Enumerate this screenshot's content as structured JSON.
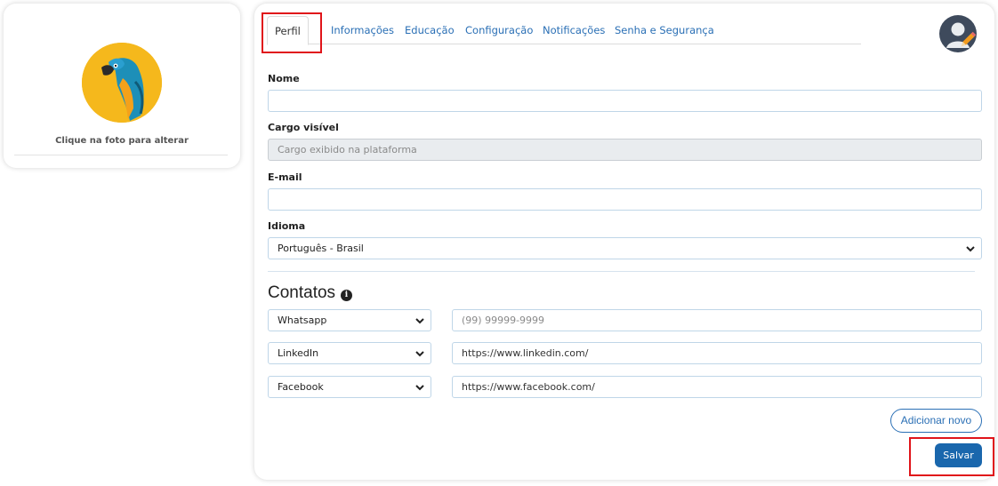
{
  "sidebar": {
    "photo_hint": "Clique na foto para alterar"
  },
  "tabs": [
    {
      "label": "Perfil",
      "active": true
    },
    {
      "label": "Informações"
    },
    {
      "label": "Educação"
    },
    {
      "label": "Configuração"
    },
    {
      "label": "Notificações"
    },
    {
      "label": "Senha e Segurança"
    }
  ],
  "form": {
    "nome": {
      "label": "Nome",
      "value": ""
    },
    "cargo": {
      "label": "Cargo visível",
      "placeholder": "Cargo exibido na plataforma"
    },
    "email": {
      "label": "E-mail",
      "value": ""
    },
    "idioma": {
      "label": "Idioma",
      "selected": "Português - Brasil"
    }
  },
  "contacts": {
    "title": "Contatos",
    "info_glyph": "i",
    "rows": [
      {
        "type": "Whatsapp",
        "value": "",
        "placeholder": "(99) 99999-9999"
      },
      {
        "type": "LinkedIn",
        "value": "https://www.linkedin.com/"
      },
      {
        "type": "Facebook",
        "value": "https://www.facebook.com/"
      }
    ],
    "add_label": "Adicionar novo"
  },
  "actions": {
    "save_label": "Salvar"
  },
  "colors": {
    "accent": "#1a67ad",
    "link": "#2a6fb5",
    "highlight": "#e0141a",
    "avatar_bg": "#f5b81c"
  },
  "icons": {
    "profile_avatar": "user-avatar-edit-icon",
    "contacts_info": "info-icon",
    "select_chevron": "chevron-down-icon"
  }
}
